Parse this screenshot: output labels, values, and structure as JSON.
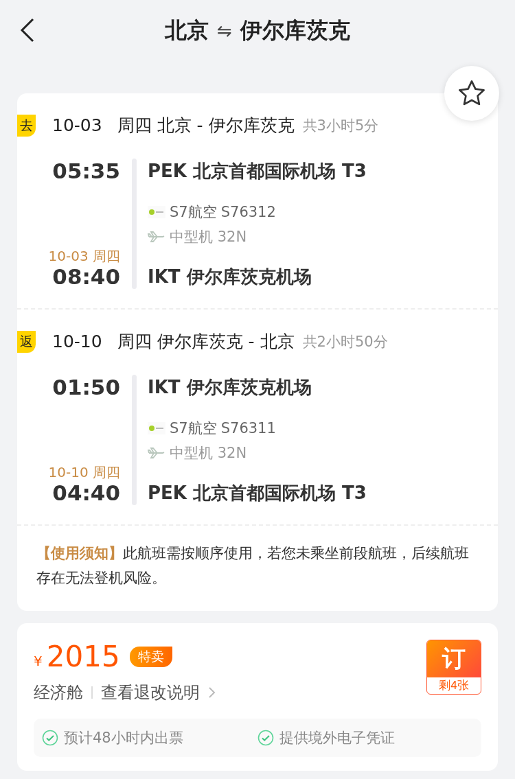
{
  "header": {
    "origin": "北京",
    "destination": "伊尔库茨克",
    "swap": "⇋"
  },
  "favorite": {
    "starred": false
  },
  "legs": [
    {
      "tag": "去",
      "date": "10-03",
      "route": "周四 北京 - 伊尔库茨克",
      "duration": "共3小时5分",
      "dep_time": "05:35",
      "dep_airport": "PEK 北京首都国际机场 T3",
      "airline": "S7航空",
      "flight_no": "S76312",
      "aircraft": "中型机 32N",
      "arr_date": "10-03 周四",
      "arr_time": "08:40",
      "arr_airport": "IKT 伊尔库茨克机场"
    },
    {
      "tag": "返",
      "date": "10-10",
      "route": "周四 伊尔库茨克 - 北京",
      "duration": "共2小时50分",
      "dep_time": "01:50",
      "dep_airport": "IKT 伊尔库茨克机场",
      "airline": "S7航空",
      "flight_no": "S76311",
      "aircraft": "中型机 32N",
      "arr_date": "10-10 周四",
      "arr_time": "04:40",
      "arr_airport": "PEK 北京首都国际机场 T3"
    }
  ],
  "notice": "**【使用须知】**此航班需按顺序使用，若您未乘坐前段航班，后续航班存在无法登机风险。",
  "offer": {
    "currency": "¥",
    "price": "2015",
    "badge": "特卖",
    "cabin": "经济舱",
    "rules_link": "查看退改说明",
    "book": "订",
    "remaining": "剩4张",
    "features": [
      "预计48小时内出票",
      "提供境外电子凭证"
    ]
  }
}
